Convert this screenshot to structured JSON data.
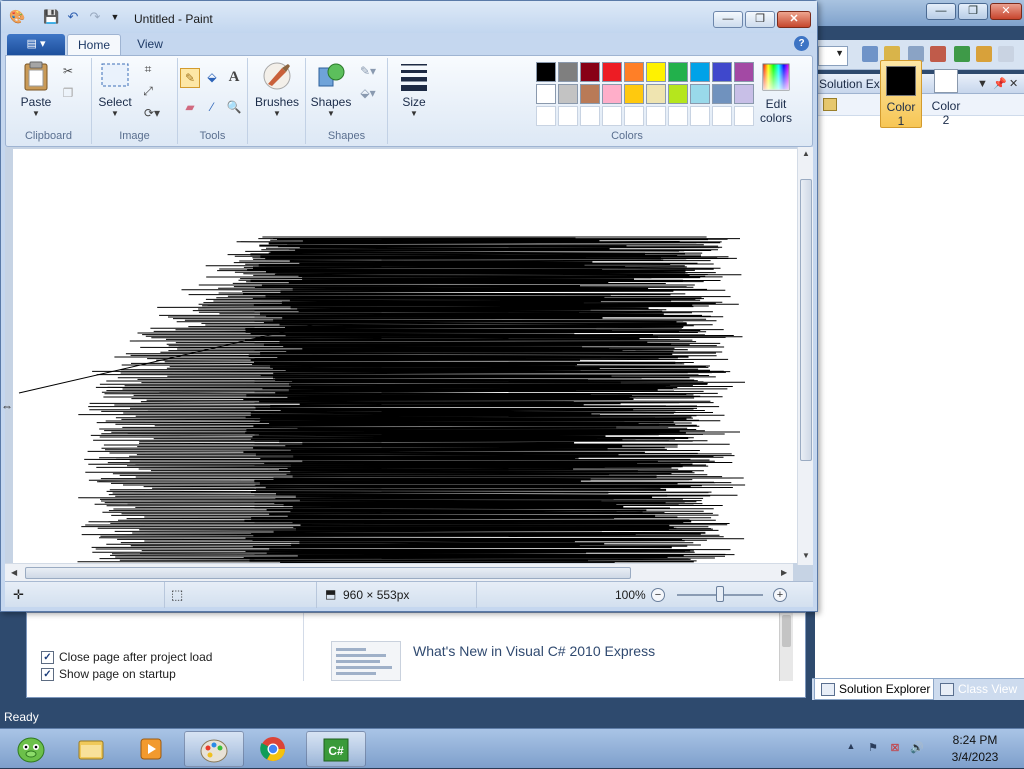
{
  "visual_studio": {
    "solution_explorer_title": "Solution Explorer",
    "tabs": [
      "Solution Explorer",
      "Class View"
    ],
    "status": "Ready",
    "start_page": {
      "close_after_load": "Close page after project load",
      "show_on_startup": "Show page on startup",
      "news_link": "What's New in Visual C# 2010 Express"
    }
  },
  "paint": {
    "title": "Untitled - Paint",
    "tabs": {
      "home": "Home",
      "view": "View"
    },
    "groups": {
      "clipboard": "Clipboard",
      "image": "Image",
      "tools": "Tools",
      "shapes": "Shapes",
      "colors": "Colors"
    },
    "buttons": {
      "paste": "Paste",
      "select": "Select",
      "brushes": "Brushes",
      "shapes": "Shapes",
      "size": "Size",
      "color1_line1": "Color",
      "color1_line2": "1",
      "color2_line1": "Color",
      "color2_line2": "2",
      "edit_colors_line1": "Edit",
      "edit_colors_line2": "colors"
    },
    "palette_row1": [
      "#000000",
      "#7f7f7f",
      "#880015",
      "#ed1c24",
      "#ff7f27",
      "#fff200",
      "#22b14c",
      "#00a2e8",
      "#3f48cc",
      "#a349a4"
    ],
    "palette_row2": [
      "#ffffff",
      "#c3c3c3",
      "#b97a57",
      "#ffaec9",
      "#ffc90e",
      "#efe4b0",
      "#b5e61d",
      "#99d9ea",
      "#7092be",
      "#c8bfe7"
    ],
    "color1": "#000000",
    "color2": "#ffffff",
    "status": {
      "dimensions": "960 × 553px",
      "zoom": "100%",
      "zoom_level": 0.5
    }
  },
  "taskbar": {
    "time": "8:24 PM",
    "date": "3/4/2023"
  }
}
